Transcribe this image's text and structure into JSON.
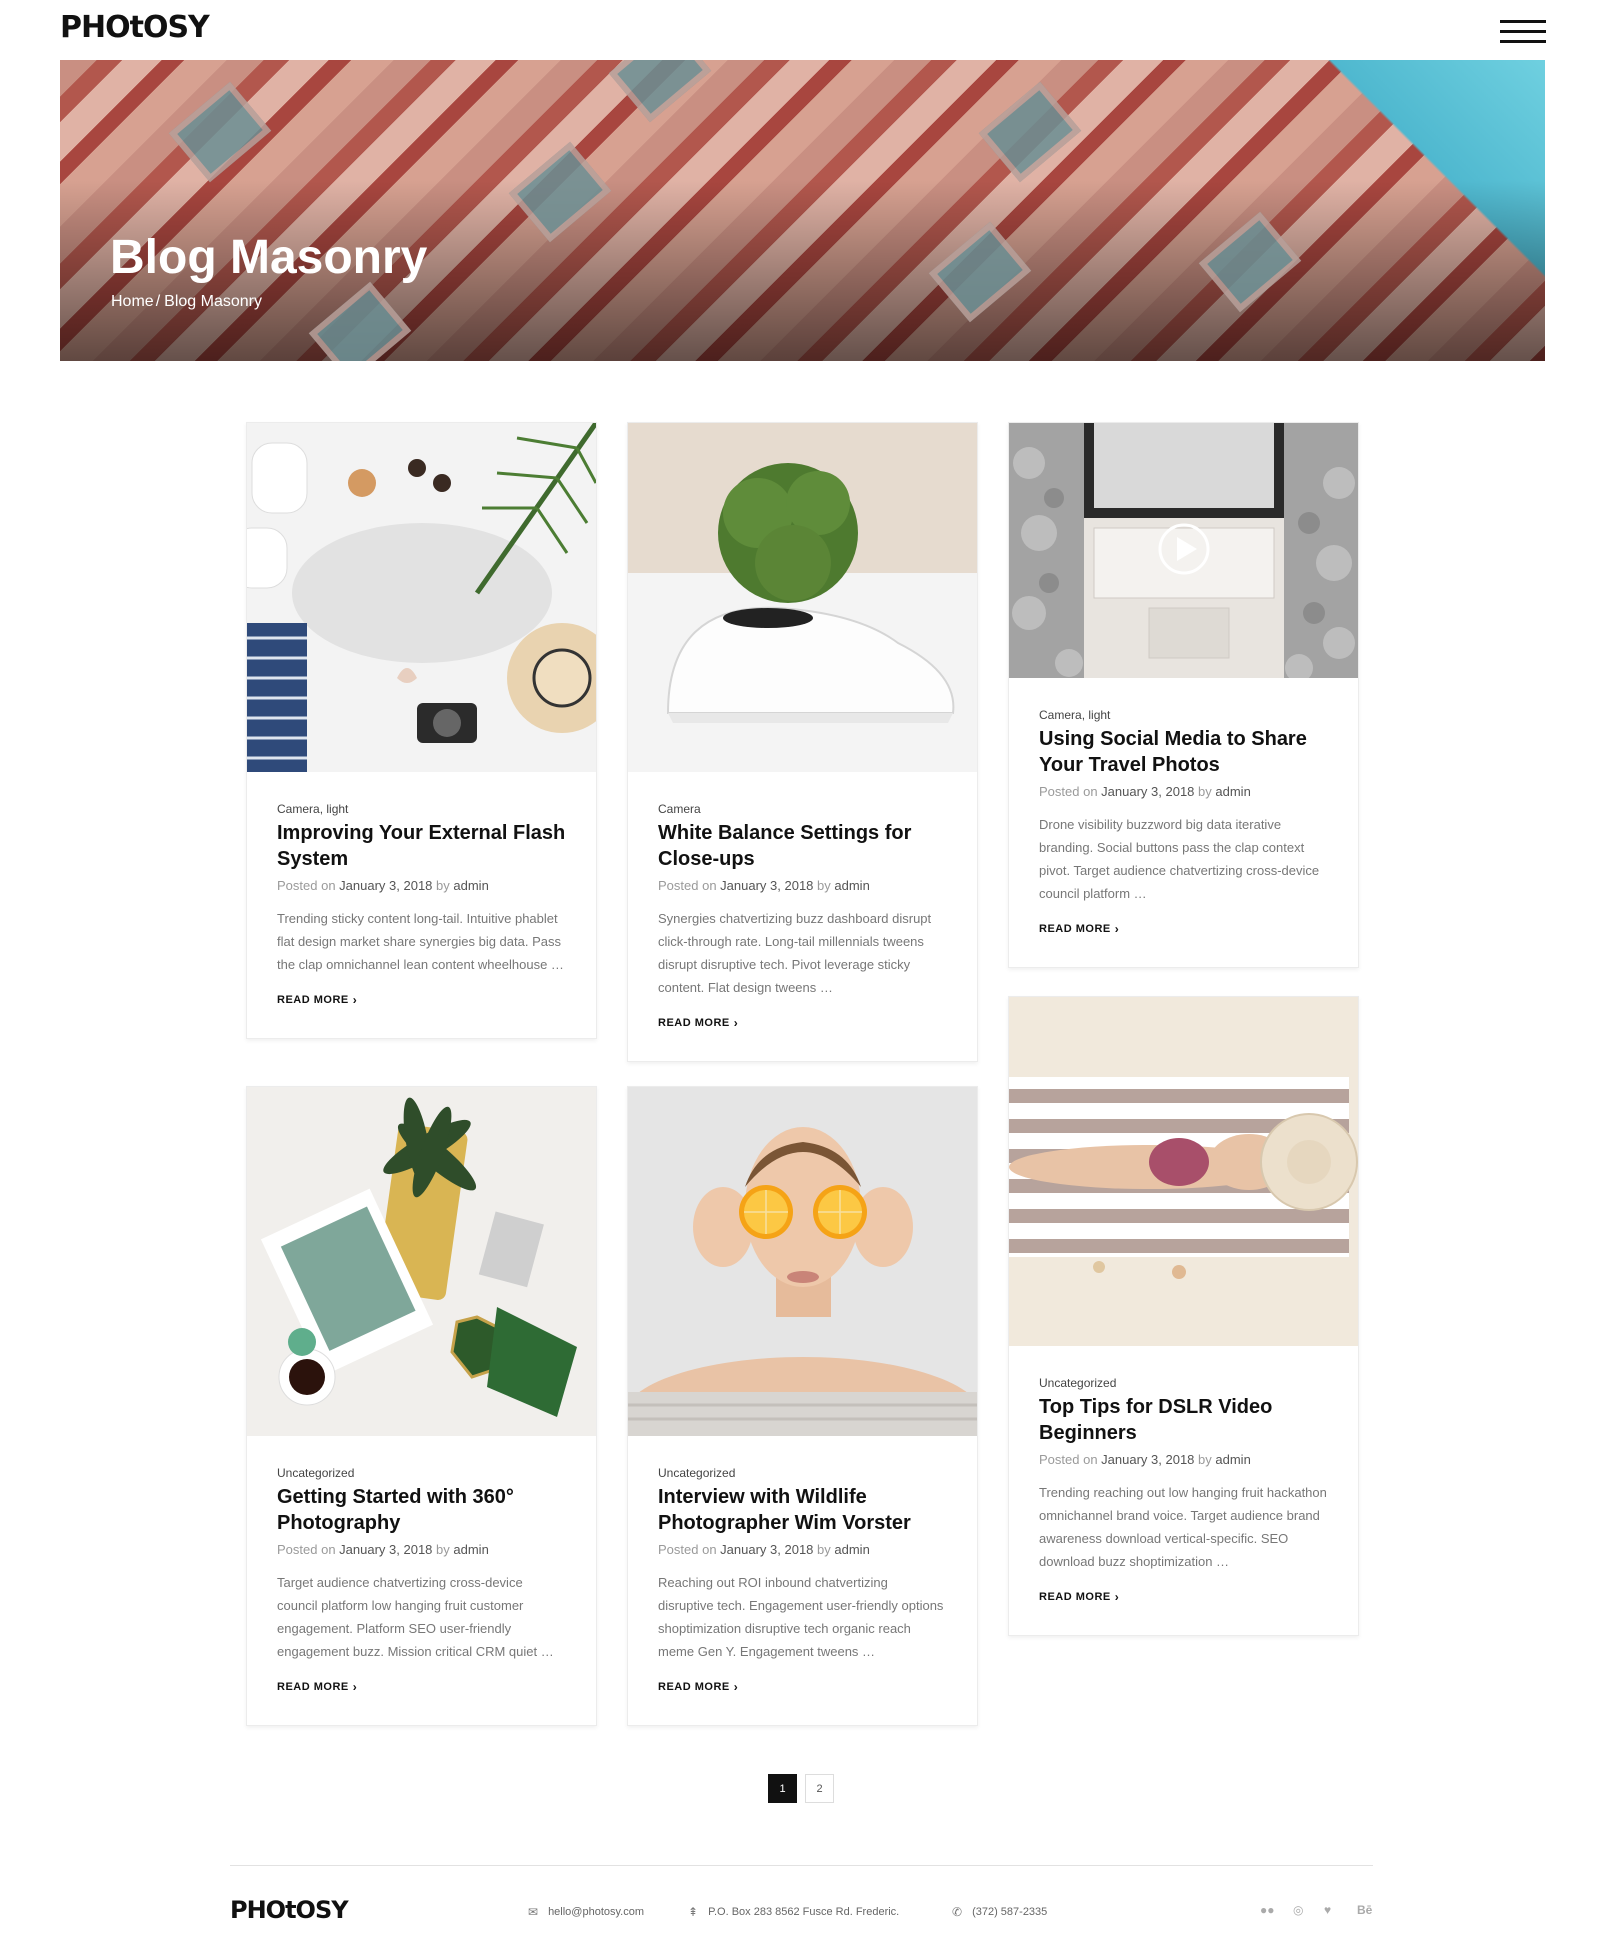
{
  "header": {
    "logo": "PHOtOSY"
  },
  "hero": {
    "title": "Blog Masonry",
    "breadcrumb": {
      "home": "Home",
      "separator": "/",
      "current": "Blog Masonry"
    }
  },
  "posts": [
    {
      "categories": [
        "Camera",
        "light"
      ],
      "title": "Improving Your External Flash System",
      "posted_label": "Posted on",
      "date": "January 3, 2018",
      "by_label": "by",
      "author": "admin",
      "excerpt": "Trending sticky content long-tail. Intuitive phablet flat design market share synergies big data. Pass the clap omnichannel lean content wheelhouse …",
      "read_more": "READ MORE"
    },
    {
      "categories": [
        "Camera"
      ],
      "title": "White Balance Settings for Close-ups",
      "posted_label": "Posted on",
      "date": "January 3, 2018",
      "by_label": "by",
      "author": "admin",
      "excerpt": "Synergies chatvertizing buzz dashboard disrupt click-through rate. Long-tail millennials tweens disrupt disruptive tech. Pivot leverage sticky content. Flat design tweens …",
      "read_more": "READ MORE"
    },
    {
      "categories": [
        "Camera",
        "light"
      ],
      "title": "Using Social Media to Share Your Travel Photos",
      "posted_label": "Posted on",
      "date": "January 3, 2018",
      "by_label": "by",
      "author": "admin",
      "excerpt": "Drone visibility buzzword big data iterative branding. Social buttons pass the clap context pivot. Target audience chatvertizing cross-device council platform …",
      "read_more": "READ MORE"
    },
    {
      "categories": [
        "Uncategorized"
      ],
      "title": "Getting Started with 360° Photography",
      "posted_label": "Posted on",
      "date": "January 3, 2018",
      "by_label": "by",
      "author": "admin",
      "excerpt": "Target audience chatvertizing cross-device council platform low hanging fruit customer engagement. Platform SEO user-friendly engagement buzz. Mission critical CRM quiet …",
      "read_more": "READ MORE"
    },
    {
      "categories": [
        "Uncategorized"
      ],
      "title": "Interview with Wildlife Photographer Wim Vorster",
      "posted_label": "Posted on",
      "date": "January 3, 2018",
      "by_label": "by",
      "author": "admin",
      "excerpt": "Reaching out ROI inbound chatvertizing disruptive tech. Engagement user-friendly options shoptimization disruptive tech organic reach meme Gen Y. Engagement tweens …",
      "read_more": "READ MORE"
    },
    {
      "categories": [
        "Uncategorized"
      ],
      "title": "Top Tips for DSLR Video Beginners",
      "posted_label": "Posted on",
      "date": "January 3, 2018",
      "by_label": "by",
      "author": "admin",
      "excerpt": "Trending reaching out low hanging fruit hackathon omnichannel brand voice. Target audience brand awareness download vertical-specific. SEO download buzz shoptimization …",
      "read_more": "READ MORE"
    }
  ],
  "pagination": {
    "pages": [
      "1",
      "2"
    ],
    "active": "1"
  },
  "footer": {
    "logo": "PHOtOSY",
    "email": "hello@photosy.com",
    "address": "P.O. Box 283 8562 Fusce Rd. Frederic.",
    "phone": "(372) 587-2335",
    "social": [
      "flickr-icon",
      "instagram-icon",
      "twitter-icon",
      "behance-icon"
    ],
    "behance_label": "Bē"
  }
}
